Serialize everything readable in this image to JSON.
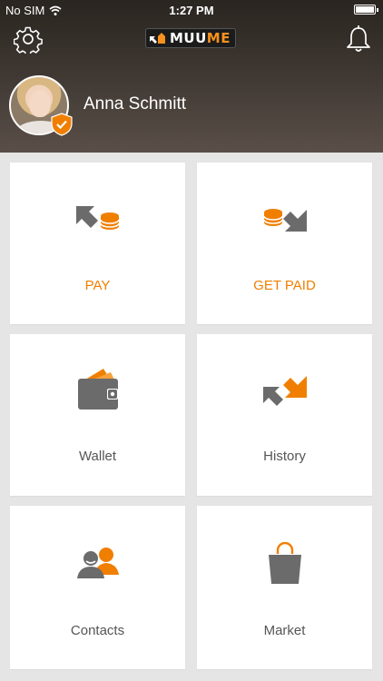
{
  "status_bar": {
    "carrier": "No SIM",
    "time": "1:27 PM"
  },
  "header": {
    "logo_text_a": "MUU",
    "logo_text_b": "ME",
    "user_name": "Anna Schmitt"
  },
  "tiles": [
    {
      "label": "PAY",
      "icon": "pay-icon"
    },
    {
      "label": "GET PAID",
      "icon": "get-paid-icon"
    },
    {
      "label": "Wallet",
      "icon": "wallet-icon"
    },
    {
      "label": "History",
      "icon": "history-icon"
    },
    {
      "label": "Contacts",
      "icon": "contacts-icon"
    },
    {
      "label": "Market",
      "icon": "market-bag-icon"
    }
  ],
  "colors": {
    "accent": "#f07f00",
    "icon_gray": "#6b6b6b",
    "background": "#e5e5e5"
  }
}
